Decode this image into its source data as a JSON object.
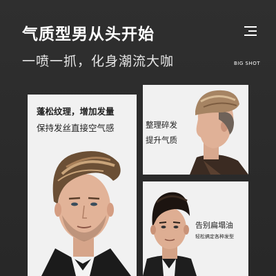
{
  "header": {
    "title": "气质型男从头开始",
    "subtitle": "一喷一抓，化身潮流大咖",
    "brand": "BIG SHOT"
  },
  "cards": {
    "left": {
      "line1": "蓬松纹理，增加发量",
      "line2": "保持发丝直接空气感"
    },
    "top_right": {
      "line1": "整理碎发",
      "line2": "提升气质"
    },
    "bottom_right": {
      "line1": "告别扁塌油",
      "line2": "轻松搞定各种发型"
    }
  },
  "colors": {
    "background": "#2b2b2b",
    "card": "#f1f1f1",
    "text_dark": "#222222",
    "text_light": "#ffffff"
  }
}
